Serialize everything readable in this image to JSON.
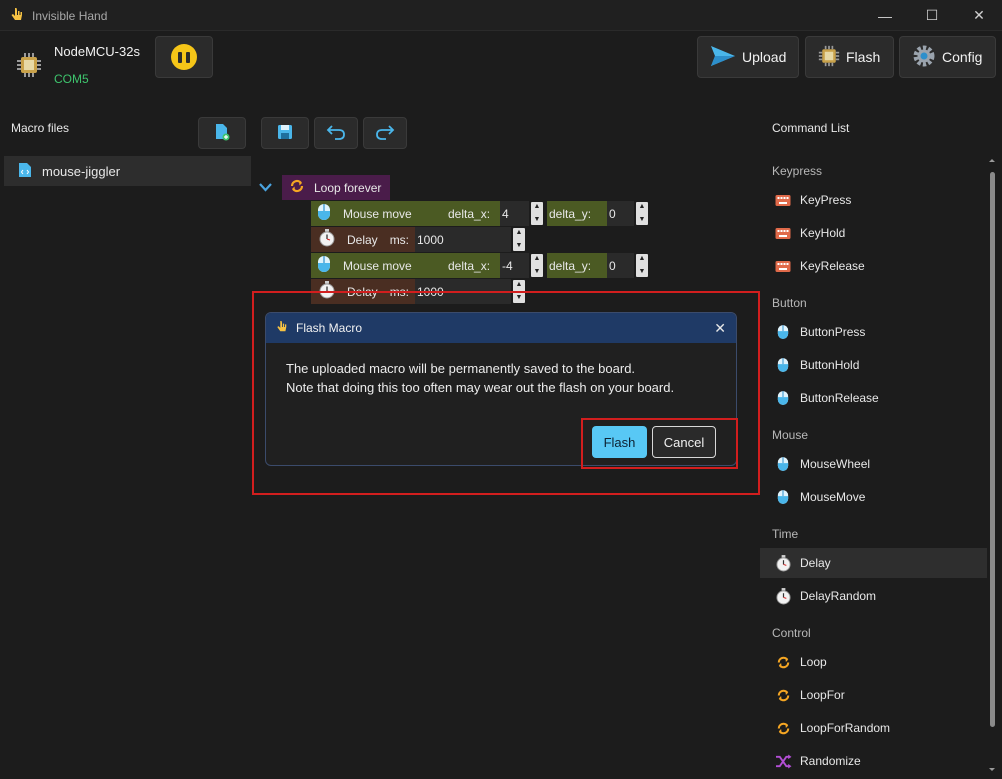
{
  "window": {
    "title": "Invisible Hand"
  },
  "device": {
    "name": "NodeMCU-32s",
    "port": "COM5"
  },
  "toolbar": {
    "upload_label": "Upload",
    "flash_label": "Flash",
    "config_label": "Config"
  },
  "macro_files": {
    "title": "Macro files",
    "files": [
      {
        "name": "mouse-jiggler"
      }
    ]
  },
  "macro": {
    "loop_label": "Loop forever",
    "rows": [
      {
        "type": "Mouse move",
        "dx_label": "delta_x:",
        "dx": "4",
        "dy_label": "delta_y:",
        "dy": "0"
      },
      {
        "type": "Delay",
        "ms_label": "ms:",
        "ms": "1000"
      },
      {
        "type": "Mouse move",
        "dx_label": "delta_x:",
        "dx": "-4",
        "dy_label": "delta_y:",
        "dy": "0"
      },
      {
        "type": "Delay",
        "ms_label": "ms:",
        "ms": "1000"
      }
    ]
  },
  "command_list": {
    "title": "Command List",
    "groups": [
      {
        "name": "Keypress",
        "items": [
          "KeyPress",
          "KeyHold",
          "KeyRelease"
        ]
      },
      {
        "name": "Button",
        "items": [
          "ButtonPress",
          "ButtonHold",
          "ButtonRelease"
        ]
      },
      {
        "name": "Mouse",
        "items": [
          "MouseWheel",
          "MouseMove"
        ]
      },
      {
        "name": "Time",
        "items": [
          "Delay",
          "DelayRandom"
        ]
      },
      {
        "name": "Control",
        "items": [
          "Loop",
          "LoopFor",
          "LoopForRandom",
          "Randomize"
        ]
      }
    ],
    "selected": "Delay"
  },
  "dialog": {
    "title": "Flash Macro",
    "message_line1": "The uploaded macro will be permanently saved to the board.",
    "message_line2": "Note that doing this too often may wear out the flash on your board.",
    "confirm_label": "Flash",
    "cancel_label": "Cancel"
  },
  "colors": {
    "background": "#1c1c1c",
    "accent": "#58c8f5",
    "port_status": "#3ec46d",
    "pause_button": "#f5c518",
    "dialog_header": "#1f3a66",
    "highlight": "#d21e1e"
  },
  "icons": [
    "hand-icon",
    "chip-icon",
    "pause-icon",
    "send-icon",
    "chip-icon",
    "gear-icon",
    "new-file-icon",
    "save-icon",
    "undo-icon",
    "redo-icon",
    "code-file-icon",
    "loop-icon",
    "mouse-icon",
    "stopwatch-icon",
    "keyboard-icon",
    "shuffle-icon",
    "close-icon"
  ]
}
